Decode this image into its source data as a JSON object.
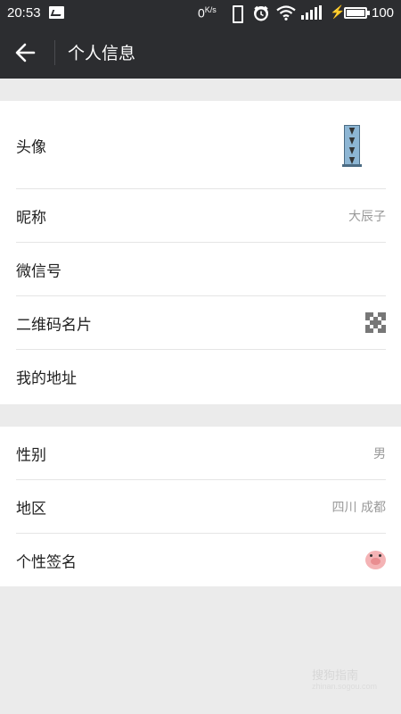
{
  "status_bar": {
    "time": "20:53",
    "net_speed": "0",
    "net_speed_unit": "K/s",
    "battery": "100",
    "icons": [
      "image-notification-icon",
      "vibrate-icon",
      "alarm-icon",
      "wifi-icon",
      "signal-icon",
      "charging-icon",
      "battery-icon"
    ]
  },
  "header": {
    "back_icon": "arrow-left-icon",
    "title": "个人信息"
  },
  "profile": {
    "avatar_label": "头像",
    "nickname_label": "昵称",
    "nickname_value": "大辰子",
    "wechat_id_label": "微信号",
    "qrcode_label": "二维码名片",
    "qrcode_icon": "qr-code-icon",
    "address_label": "我的地址"
  },
  "details": {
    "gender_label": "性别",
    "gender_value": "男",
    "region_label": "地区",
    "region_value": "四川 成都",
    "signature_label": "个性签名",
    "signature_icon": "pig-emoji-icon"
  },
  "watermark": {
    "text": "搜狗指南",
    "sub": "zhinan.sogou.com"
  },
  "colors": {
    "header_bg": "#2c2d30",
    "page_bg": "#ebebeb",
    "card_bg": "#ffffff",
    "value_gray": "#999999"
  }
}
